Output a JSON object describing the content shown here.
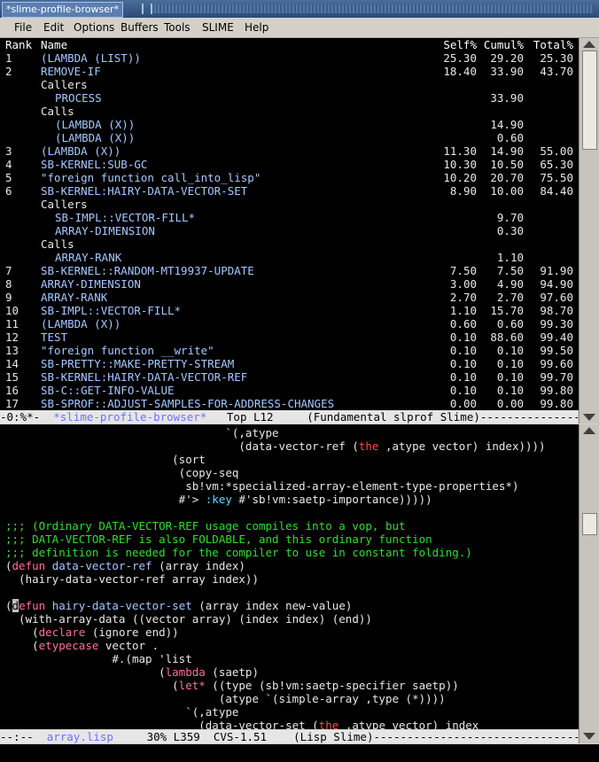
{
  "window": {
    "title": "*slime-profile-browser*"
  },
  "menubar": {
    "items": [
      "File",
      "Edit",
      "Options",
      "Buffers",
      "Tools",
      "SLIME",
      "Help"
    ]
  },
  "profile": {
    "header": {
      "rank": "Rank",
      "name": "Name",
      "self": "Self%",
      "cumul": "Cumul%",
      "total": "Total%"
    },
    "rows": [
      {
        "rank": "1",
        "name": "(LAMBDA (LIST))",
        "self": "25.30",
        "cumul": "29.20",
        "total": "25.30",
        "kind": "entry"
      },
      {
        "rank": "2",
        "name": "REMOVE-IF",
        "self": "18.40",
        "cumul": "33.90",
        "total": "43.70",
        "kind": "entry"
      },
      {
        "rank": "",
        "name": "Callers",
        "self": "",
        "cumul": "",
        "total": "",
        "kind": "section"
      },
      {
        "rank": "",
        "name": "PROCESS",
        "self": "",
        "cumul": "33.90",
        "total": "",
        "kind": "sub"
      },
      {
        "rank": "",
        "name": "Calls",
        "self": "",
        "cumul": "",
        "total": "",
        "kind": "section"
      },
      {
        "rank": "",
        "name": "(LAMBDA (X))",
        "self": "",
        "cumul": "14.90",
        "total": "",
        "kind": "sub"
      },
      {
        "rank": "",
        "name": "(LAMBDA (X))",
        "self": "",
        "cumul": "0.60",
        "total": "",
        "kind": "sub"
      },
      {
        "rank": "3",
        "name": "(LAMBDA (X))",
        "self": "11.30",
        "cumul": "14.90",
        "total": "55.00",
        "kind": "entry"
      },
      {
        "rank": "4",
        "name": "SB-KERNEL:SUB-GC",
        "self": "10.30",
        "cumul": "10.50",
        "total": "65.30",
        "kind": "entry"
      },
      {
        "rank": "5",
        "name": "\"foreign function call_into_lisp\"",
        "self": "10.20",
        "cumul": "20.70",
        "total": "75.50",
        "kind": "entry"
      },
      {
        "rank": "6",
        "name": "SB-KERNEL:HAIRY-DATA-VECTOR-SET",
        "self": "8.90",
        "cumul": "10.00",
        "total": "84.40",
        "kind": "entry"
      },
      {
        "rank": "",
        "name": "Callers",
        "self": "",
        "cumul": "",
        "total": "",
        "kind": "section"
      },
      {
        "rank": "",
        "name": "SB-IMPL::VECTOR-FILL*",
        "self": "",
        "cumul": "9.70",
        "total": "",
        "kind": "sub"
      },
      {
        "rank": "",
        "name": "ARRAY-DIMENSION",
        "self": "",
        "cumul": "0.30",
        "total": "",
        "kind": "sub"
      },
      {
        "rank": "",
        "name": "Calls",
        "self": "",
        "cumul": "",
        "total": "",
        "kind": "section"
      },
      {
        "rank": "",
        "name": "ARRAY-RANK",
        "self": "",
        "cumul": "1.10",
        "total": "",
        "kind": "sub"
      },
      {
        "rank": "7",
        "name": "SB-KERNEL::RANDOM-MT19937-UPDATE",
        "self": "7.50",
        "cumul": "7.50",
        "total": "91.90",
        "kind": "entry"
      },
      {
        "rank": "8",
        "name": "ARRAY-DIMENSION",
        "self": "3.00",
        "cumul": "4.90",
        "total": "94.90",
        "kind": "entry"
      },
      {
        "rank": "9",
        "name": "ARRAY-RANK",
        "self": "2.70",
        "cumul": "2.70",
        "total": "97.60",
        "kind": "entry"
      },
      {
        "rank": "10",
        "name": "SB-IMPL::VECTOR-FILL*",
        "self": "1.10",
        "cumul": "15.70",
        "total": "98.70",
        "kind": "entry"
      },
      {
        "rank": "11",
        "name": "(LAMBDA (X))",
        "self": "0.60",
        "cumul": "0.60",
        "total": "99.30",
        "kind": "entry"
      },
      {
        "rank": "12",
        "name": "TEST",
        "self": "0.10",
        "cumul": "88.60",
        "total": "99.40",
        "kind": "entry"
      },
      {
        "rank": "13",
        "name": "\"foreign function __write\"",
        "self": "0.10",
        "cumul": "0.10",
        "total": "99.50",
        "kind": "entry"
      },
      {
        "rank": "14",
        "name": "SB-PRETTY::MAKE-PRETTY-STREAM",
        "self": "0.10",
        "cumul": "0.10",
        "total": "99.60",
        "kind": "entry"
      },
      {
        "rank": "15",
        "name": "SB-KERNEL:HAIRY-DATA-VECTOR-REF",
        "self": "0.10",
        "cumul": "0.10",
        "total": "99.70",
        "kind": "entry"
      },
      {
        "rank": "16",
        "name": "SB-C::GET-INFO-VALUE",
        "self": "0.10",
        "cumul": "0.10",
        "total": "99.80",
        "kind": "entry"
      },
      {
        "rank": "17",
        "name": "SB-SPROF::ADJUST-SAMPLES-FOR-ADDRESS-CHANGES",
        "self": "0.00",
        "cumul": "0.00",
        "total": "99.80",
        "kind": "entry"
      }
    ],
    "modeline": {
      "status": "-0:%*-  ",
      "buffer": "*slime-profile-browser*",
      "position": "   Top L12     ",
      "modes": "(Fundamental slprof Slime)",
      "fill": "---------------"
    }
  },
  "source": {
    "lines": [
      [
        {
          "t": "                                 `(,atype",
          "c": "w"
        }
      ],
      [
        {
          "t": "                                   (data-vector-ref (",
          "c": "w"
        },
        {
          "t": "the",
          "c": "red"
        },
        {
          "t": " ,atype vector) index))))",
          "c": "w"
        }
      ],
      [
        {
          "t": "                         (sort",
          "c": "w"
        }
      ],
      [
        {
          "t": "                          (copy-seq",
          "c": "w"
        }
      ],
      [
        {
          "t": "                           sb!vm:*specialized-array-element-type-properties*)",
          "c": "w"
        }
      ],
      [
        {
          "t": "                          #'> ",
          "c": "w"
        },
        {
          "t": ":key",
          "c": "cyan"
        },
        {
          "t": " #'sb!vm:saetp-importance)))))",
          "c": "w"
        }
      ],
      [
        {
          "t": "",
          "c": "w"
        }
      ],
      [
        {
          "t": ";;; (Ordinary DATA-VECTOR-REF usage compiles into a vop, but",
          "c": "green"
        }
      ],
      [
        {
          "t": ";;; DATA-VECTOR-REF is also FOLDABLE, and this ordinary function",
          "c": "green"
        }
      ],
      [
        {
          "t": ";;; definition is needed for the compiler to use in constant folding.)",
          "c": "green"
        }
      ],
      [
        {
          "t": "(",
          "c": "w"
        },
        {
          "t": "defun",
          "c": "pink"
        },
        {
          "t": " ",
          "c": "w"
        },
        {
          "t": "data-vector-ref",
          "c": "blue"
        },
        {
          "t": " (array index)",
          "c": "w"
        }
      ],
      [
        {
          "t": "  (hairy-data-vector-ref array index))",
          "c": "w"
        }
      ],
      [
        {
          "t": "",
          "c": "w"
        }
      ],
      [
        {
          "t": "(",
          "c": "w"
        },
        {
          "t": "d",
          "c": "cursor"
        },
        {
          "t": "efun",
          "c": "pink"
        },
        {
          "t": " ",
          "c": "w"
        },
        {
          "t": "hairy-data-vector-set",
          "c": "blue"
        },
        {
          "t": " (array index new-value)",
          "c": "w"
        }
      ],
      [
        {
          "t": "  (with-array-data ((vector array) (index index) (end))",
          "c": "w"
        }
      ],
      [
        {
          "t": "    (",
          "c": "w"
        },
        {
          "t": "declare",
          "c": "pink"
        },
        {
          "t": " (ignore end))",
          "c": "w"
        }
      ],
      [
        {
          "t": "    (",
          "c": "w"
        },
        {
          "t": "etypecase",
          "c": "pink"
        },
        {
          "t": " vector .",
          "c": "w"
        }
      ],
      [
        {
          "t": "                #.(map 'list",
          "c": "w"
        }
      ],
      [
        {
          "t": "                       (",
          "c": "w"
        },
        {
          "t": "lambda",
          "c": "pink"
        },
        {
          "t": " (saetp)",
          "c": "w"
        }
      ],
      [
        {
          "t": "                         (",
          "c": "w"
        },
        {
          "t": "let*",
          "c": "pink"
        },
        {
          "t": " ((type (sb!vm:saetp-specifier saetp))",
          "c": "w"
        }
      ],
      [
        {
          "t": "                                (atype `(simple-array ,type (*))))",
          "c": "w"
        }
      ],
      [
        {
          "t": "                           `(,atype",
          "c": "w"
        }
      ],
      [
        {
          "t": "                             (data-vector-set (",
          "c": "w"
        },
        {
          "t": "the",
          "c": "red"
        },
        {
          "t": " ,atype vector) index",
          "c": "w"
        }
      ]
    ],
    "modeline": {
      "status": "--:--  ",
      "buffer": "array.lisp",
      "position": "     30% L359  CVS-1.51    ",
      "modes": "(Lisp Slime)",
      "fill": "----------------------------------------"
    }
  },
  "colors": {
    "background": "#000000",
    "comment": "#33dd33",
    "keyword": "#ff6f9a",
    "function_name": "#a6c8ff",
    "modeline_buffer": "#6f6fff"
  }
}
